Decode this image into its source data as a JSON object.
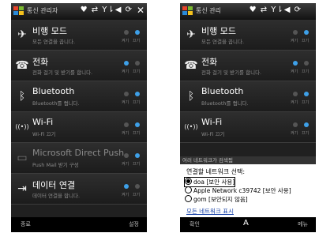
{
  "left_screen": {
    "title": "통신 관리자",
    "status_icons": "♥ ⇄ Y⇂◀ ⟳",
    "items": [
      {
        "name": "비행 모드",
        "desc": "모든 연결을 끕니다.",
        "toggle": [
          "켜기",
          "끄기"
        ],
        "on": 1,
        "icon": "airplane-icon",
        "glyph": "✈"
      },
      {
        "name": "전화",
        "desc": "전화 걸기 및 받기를 합니다.",
        "toggle": [
          "켜기",
          "끄기"
        ],
        "on": 0,
        "icon": "phone-icon",
        "glyph": "☎"
      },
      {
        "name": "Bluetooth",
        "desc": "Bluetooth를 켭니다.",
        "toggle": [
          "켜기",
          "끄기"
        ],
        "on": 1,
        "icon": "bluetooth-icon",
        "glyph": "ᛒ"
      },
      {
        "name": "Wi-Fi",
        "desc": "Wi-Fi 끄기",
        "toggle": [
          "켜기",
          "끄기"
        ],
        "on": 1,
        "icon": "wifi-icon",
        "glyph": "((•))"
      },
      {
        "name": "Microsoft Direct Push",
        "desc": "Push Mail 받기 구성",
        "toggle": [
          "켜기",
          "끄기"
        ],
        "on": 1,
        "icon": "direct-push-icon",
        "glyph": "▭",
        "disabled": true
      },
      {
        "name": "데이터 연결",
        "desc": "데이터 연결을 합니다.",
        "toggle": [
          "켜기",
          "끄기"
        ],
        "on": 0,
        "icon": "data-connection-icon",
        "glyph": "⇥"
      }
    ],
    "bottom_left": "종료",
    "bottom_right": "설정"
  },
  "right_screen": {
    "title": "통신 관리",
    "status_icons": "♥ ⇄ Y⇂◀ ⟳",
    "items": [
      {
        "name": "비행 모드",
        "desc": "모든 연결을 끕니다.",
        "toggle": [
          "켜기",
          "끄기"
        ],
        "on": 1,
        "icon": "airplane-icon",
        "glyph": "✈"
      },
      {
        "name": "전화",
        "desc": "전화 걸기 및 받기를 합니다.",
        "toggle": [
          "켜기",
          "끄기"
        ],
        "on": 0,
        "icon": "phone-icon",
        "glyph": "☎"
      },
      {
        "name": "Bluetooth",
        "desc": "Bluetooth를 켭니다.",
        "toggle": [
          "켜기",
          "끄기"
        ],
        "on": 1,
        "icon": "bluetooth-icon",
        "glyph": "ᛒ"
      },
      {
        "name": "Wi-Fi",
        "desc": "Wi-Fi 끄기",
        "toggle": [
          "켜기",
          "끄기"
        ],
        "on": 1,
        "icon": "wifi-icon",
        "glyph": "((•))"
      }
    ],
    "dialog": {
      "header": "여러 네트워크가 검색됨",
      "prompt": "연결할 네트워크 선택:",
      "options": [
        "doa [보안 사용]",
        "Apple Network c39742 [보안 사용]",
        "gom [보안되지 않음]"
      ],
      "selected": 0,
      "link": "모든 네트워크 표시"
    },
    "bottom_left": "확인",
    "bottom_mid": "A",
    "bottom_right": "메뉴"
  },
  "colors": {
    "accent": "#3ea0e8",
    "background": "#202020"
  }
}
